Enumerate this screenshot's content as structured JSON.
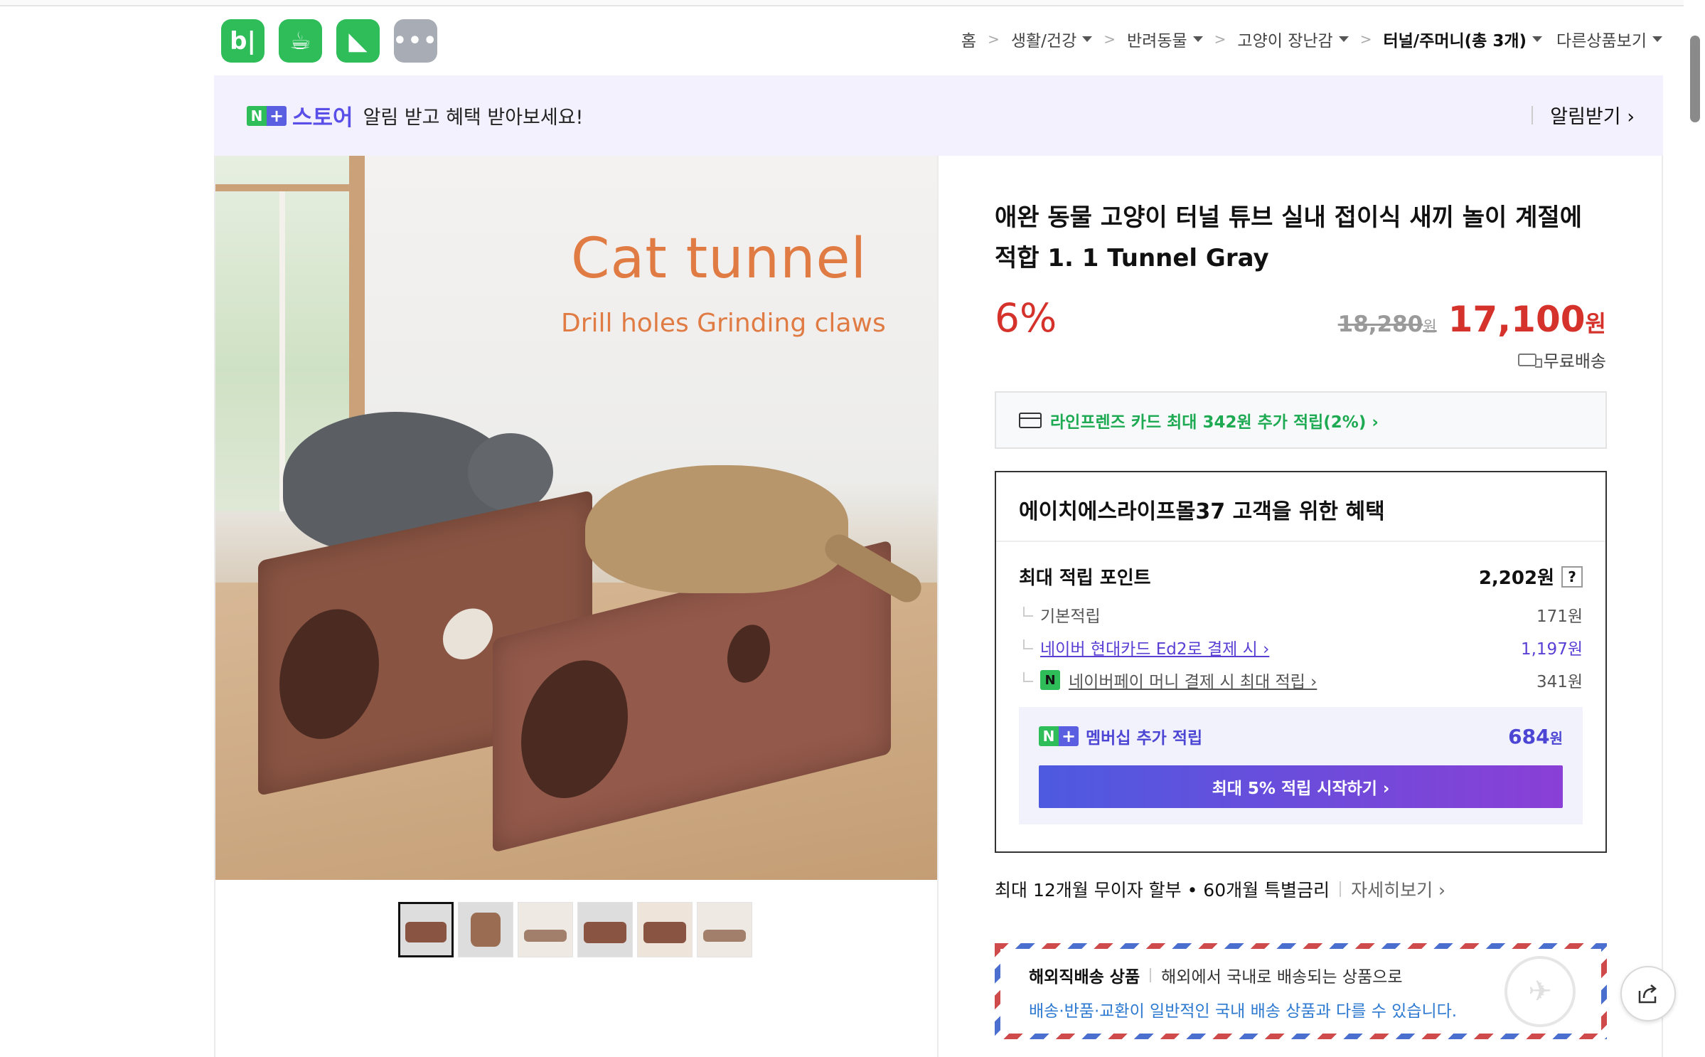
{
  "apps": [
    {
      "icon": "blog-icon",
      "glyph": "b|"
    },
    {
      "icon": "cafe-icon",
      "glyph": "☕"
    },
    {
      "icon": "bookmark-icon",
      "glyph": "◣"
    },
    {
      "icon": "more-icon",
      "glyph": "•••"
    }
  ],
  "breadcrumb": {
    "home": "홈",
    "cat1": "생활/건강",
    "cat2": "반려동물",
    "cat3": "고양이 장난감",
    "cat4": "터널/주머니(총 3개)",
    "other": "다른상품보기"
  },
  "banner": {
    "n": "N",
    "plus": "+",
    "store": "스토어",
    "message": "알림 받고 혜택 받아보세요!",
    "subscribe": "알림받기 ›"
  },
  "image": {
    "headline": "Cat tunnel",
    "subline": "Drill holes Grinding claws"
  },
  "product": {
    "title": "애완 동물 고양이 터널 튜브 실내 접이식 새끼 놀이 계절에 적합 1. 1 Tunnel Gray",
    "discount": "6%",
    "old_price": "18,280",
    "old_unit": "원",
    "new_price": "17,100",
    "new_unit": "원",
    "shipping": "무료배송"
  },
  "card_offer": "라인프렌즈 카드 최대 342원 추가 적립(2%) ›",
  "benefit": {
    "title": "에이치에스라이프몰37 고객을 위한 혜택",
    "max_points_label": "최대 적립 포인트",
    "max_points_value": "2,202원",
    "help": "?",
    "rows": [
      {
        "label": "기본적립",
        "value": "171원"
      },
      {
        "label": "네이버 현대카드 Ed2로 결제 시 ›",
        "value": "1,197원"
      },
      {
        "label": "네이버페이 머니 결제 시 최대 적립 ›",
        "value": "341원"
      }
    ],
    "npay_badge": "N",
    "member_label": "멤버십 추가 적립",
    "member_value": "684",
    "member_unit": "원",
    "member_button": "최대 5% 적립 시작하기 ›"
  },
  "installment": {
    "text": "최대 12개월 무이자 할부 • 60개월 특별금리",
    "more": "자세히보기 ›"
  },
  "overseas": {
    "label": "해외직배송 상품",
    "desc": "해외에서 국내로 배송되는 상품으로",
    "warning": "배송·반품·교환이 일반적인 국내 배송 상품과 다를 수 있습니다.",
    "stamp": "✈"
  },
  "thumbnails": [
    "thumbnail-1",
    "thumbnail-2",
    "thumbnail-3",
    "thumbnail-4",
    "thumbnail-5",
    "thumbnail-6"
  ],
  "colors": {
    "accent": "#2ebd59",
    "price": "#d4322b",
    "membership": "#4d46d4"
  }
}
